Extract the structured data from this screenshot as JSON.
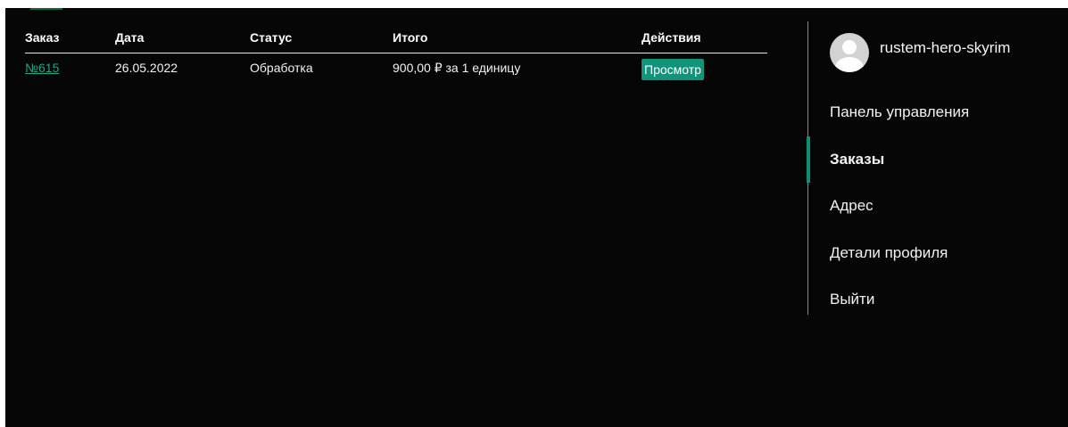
{
  "orders_table": {
    "headers": [
      "Заказ",
      "Дата",
      "Статус",
      "Итого",
      "Действия"
    ],
    "rows": [
      {
        "order": "№615",
        "date": "26.05.2022",
        "status": "Обработка",
        "total": "900,00 ₽ за 1 единицу",
        "action": "Просмотр"
      }
    ]
  },
  "account": {
    "username": "rustem-hero-skyrim",
    "nav": [
      {
        "label": "Панель управления",
        "active": false
      },
      {
        "label": "Заказы",
        "active": true
      },
      {
        "label": "Адрес",
        "active": false
      },
      {
        "label": "Детали профиля",
        "active": false
      },
      {
        "label": "Выйти",
        "active": false
      }
    ]
  },
  "colors": {
    "background": "#060606",
    "accent": "#10957a",
    "link": "#1fa689",
    "text": "#f2f2f2"
  },
  "icons": {
    "avatar": "user-avatar-icon"
  }
}
